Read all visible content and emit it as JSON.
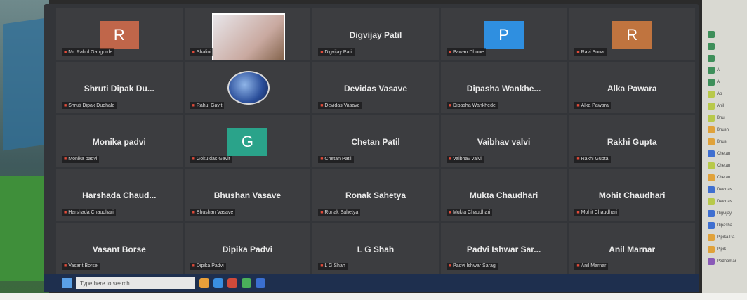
{
  "participants": [
    {
      "name": "",
      "avatar": "R",
      "avatar_color": "#c0664a",
      "label": "Mr. Rahul Gangurde",
      "type": "avatar"
    },
    {
      "name": "",
      "avatar": "",
      "label": "Shalini",
      "type": "photo"
    },
    {
      "name": "Digvijay Patil",
      "avatar": "",
      "label": "Digvijay Patil",
      "type": "name"
    },
    {
      "name": "",
      "avatar": "P",
      "avatar_color": "#2f8fe0",
      "label": "Pawan Dhone",
      "type": "avatar"
    },
    {
      "name": "",
      "avatar": "R",
      "avatar_color": "#c0743f",
      "label": "Ravi Sonar",
      "type": "avatar"
    },
    {
      "name": "Shruti Dipak Du...",
      "avatar": "",
      "label": "Shruti Dipak Dudhale",
      "type": "name"
    },
    {
      "name": "",
      "avatar": "",
      "label": "Rahul Gavit",
      "type": "globe"
    },
    {
      "name": "Devidas Vasave",
      "avatar": "",
      "label": "Devidas Vasave",
      "type": "name"
    },
    {
      "name": "Dipasha Wankhe...",
      "avatar": "",
      "label": "Dipasha Wankhede",
      "type": "name"
    },
    {
      "name": "Alka Pawara",
      "avatar": "",
      "label": "Alka Pawara",
      "type": "name"
    },
    {
      "name": "Monika padvi",
      "avatar": "",
      "label": "Monika padvi",
      "type": "name"
    },
    {
      "name": "",
      "avatar": "G",
      "avatar_color": "#2aa38a",
      "label": "Gokuldas Gavit",
      "type": "avatar"
    },
    {
      "name": "Chetan Patil",
      "avatar": "",
      "label": "Chetan Patil",
      "type": "name"
    },
    {
      "name": "Vaibhav valvi",
      "avatar": "",
      "label": "Vaibhav valvi",
      "type": "name"
    },
    {
      "name": "Rakhi Gupta",
      "avatar": "",
      "label": "Rakhi Gupta",
      "type": "name"
    },
    {
      "name": "Harshada Chaud...",
      "avatar": "",
      "label": "Harshada Chaudhari",
      "type": "name"
    },
    {
      "name": "Bhushan Vasave",
      "avatar": "",
      "label": "Bhushan Vasave",
      "type": "name"
    },
    {
      "name": "Ronak Sahetya",
      "avatar": "",
      "label": "Ronak Sahetya",
      "type": "name"
    },
    {
      "name": "Mukta Chaudhari",
      "avatar": "",
      "label": "Mukta Chaudhari",
      "type": "name"
    },
    {
      "name": "Mohit Chaudhari",
      "avatar": "",
      "label": "Mohit Chaudhari",
      "type": "name"
    },
    {
      "name": "Vasant Borse",
      "avatar": "",
      "label": "Vasant Borse",
      "type": "name"
    },
    {
      "name": "Dipika Padvi",
      "avatar": "",
      "label": "Dipika Padvi",
      "type": "name"
    },
    {
      "name": "L G Shah",
      "avatar": "",
      "label": "L G Shah",
      "type": "name"
    },
    {
      "name": "Padvi Ishwar Sar...",
      "avatar": "",
      "label": "Padvi Ishwar Sarag",
      "type": "name"
    },
    {
      "name": "Anil Marnar",
      "avatar": "",
      "label": "Anil Marnar",
      "type": "name"
    }
  ],
  "taskbar": {
    "search_placeholder": "Type here to search"
  },
  "side_list": [
    {
      "initial": "",
      "color": "#3e8f5a",
      "text": ""
    },
    {
      "initial": "",
      "color": "#3e8f5a",
      "text": ""
    },
    {
      "initial": "",
      "color": "#3e8f5a",
      "text": ""
    },
    {
      "initial": "",
      "color": "#3e8f5a",
      "text": "Al"
    },
    {
      "initial": "",
      "color": "#3e8f5a",
      "text": "Al"
    },
    {
      "initial": "",
      "color": "#b8c94a",
      "text": "Ab"
    },
    {
      "initial": "",
      "color": "#b8c94a",
      "text": "Anil"
    },
    {
      "initial": "",
      "color": "#b8c94a",
      "text": "Bhu"
    },
    {
      "initial": "",
      "color": "#e0a23a",
      "text": "Bhush"
    },
    {
      "initial": "",
      "color": "#e0a23a",
      "text": "Bhus"
    },
    {
      "initial": "",
      "color": "#3f6fd0",
      "text": "Chetan"
    },
    {
      "initial": "",
      "color": "#b8c94a",
      "text": "Chetan"
    },
    {
      "initial": "",
      "color": "#e0a23a",
      "text": "Chetan"
    },
    {
      "initial": "",
      "color": "#3f6fd0",
      "text": "Devidas"
    },
    {
      "initial": "",
      "color": "#b8c94a",
      "text": "Devidas"
    },
    {
      "initial": "",
      "color": "#3f6fd0",
      "text": "Digvijay"
    },
    {
      "initial": "",
      "color": "#3f6fd0",
      "text": "Dipasha"
    },
    {
      "initial": "",
      "color": "#e0a23a",
      "text": "Pipika Pa"
    },
    {
      "initial": "",
      "color": "#e0a23a",
      "text": "Pipik"
    },
    {
      "initial": "",
      "color": "#8a5ab8",
      "text": "Pednomar"
    }
  ]
}
